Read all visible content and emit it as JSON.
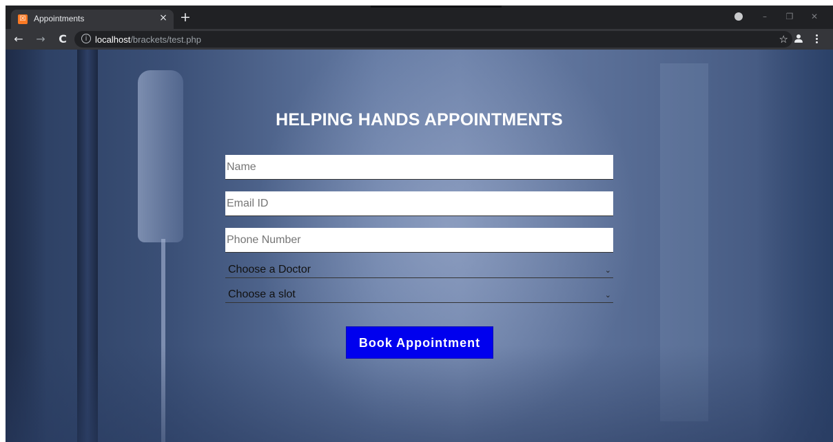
{
  "browser": {
    "tab_title": "Appointments",
    "tab_close_glyph": "×",
    "new_tab_glyph": "+",
    "url_host": "localhost",
    "url_path": "/brackets/test.php",
    "info_glyph": "i",
    "star_glyph": "☆",
    "back_glyph": "←",
    "forward_glyph": "→",
    "reload_glyph": "C",
    "minimize_glyph": "–",
    "maximize_glyph": "❐",
    "close_glyph": "✕",
    "favicon_glyph": "☒",
    "icons": [
      "favicon-icon",
      "close-icon",
      "plus-icon",
      "back-arrow-icon",
      "forward-arrow-icon",
      "reload-icon",
      "info-icon",
      "star-icon",
      "account-icon",
      "more-vert-icon"
    ]
  },
  "page": {
    "title": "HELPING HANDS APPOINTMENTS",
    "form": {
      "name_placeholder": "Name",
      "email_placeholder": "Email ID",
      "phone_placeholder": "Phone Number",
      "doctor_select": "Choose a Doctor",
      "slot_select": "Choose a slot",
      "chevron_glyph": "⌄",
      "submit_label": "Book Appointment"
    },
    "colors": {
      "button_bg": "#0000ee",
      "button_text": "#ffffff",
      "title_text": "#ffffff"
    }
  }
}
